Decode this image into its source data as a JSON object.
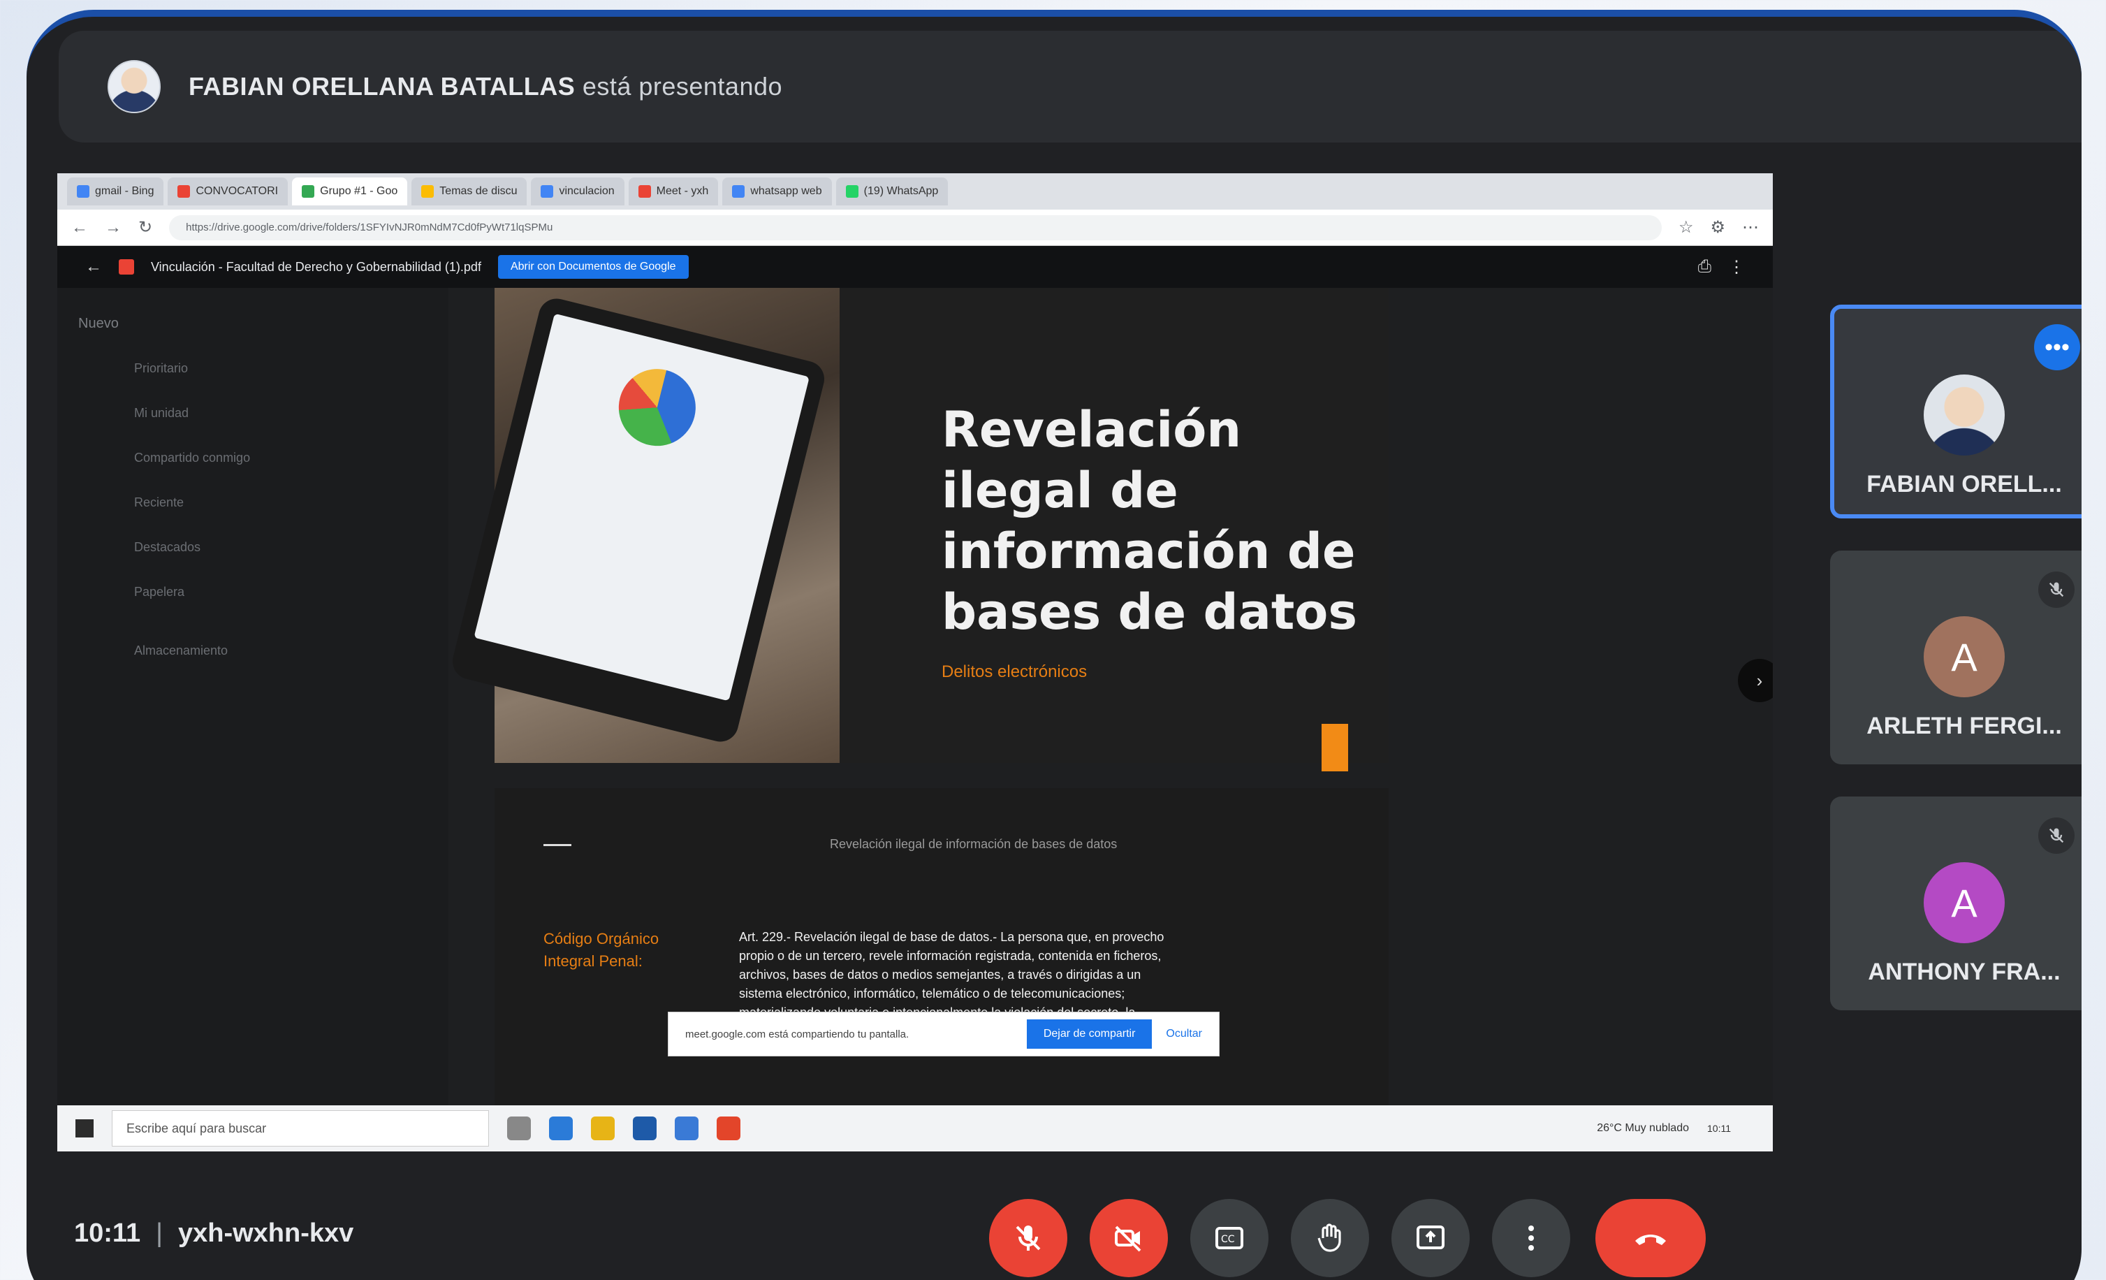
{
  "meeting": {
    "presenter_name": "FABIAN ORELLANA BATALLAS",
    "presenting_text": "está presentando",
    "time": "10:11",
    "code": "yxh-wxhn-kxv"
  },
  "browser": {
    "tabs": [
      {
        "label": "gmail - Bing"
      },
      {
        "label": "CONVOCATORI"
      },
      {
        "label": "Grupo #1 - Goo"
      },
      {
        "label": "Temas de discu"
      },
      {
        "label": "vinculacion"
      },
      {
        "label": "Meet - yxh"
      },
      {
        "label": "whatsapp web"
      },
      {
        "label": "(19) WhatsApp"
      }
    ],
    "url": "https://drive.google.com/drive/folders/1SFYIvNJR0mNdM7Cd0fPyWt71lqSPMu"
  },
  "drive": {
    "file_title": "Vinculación - Facultad de Derecho y Gobernabilidad (1).pdf",
    "open_with": "Abrir con Documentos de Google",
    "new_label": "Nuevo",
    "side_items": [
      {
        "label": "Prioritario"
      },
      {
        "label": "Mi unidad"
      },
      {
        "label": "Compartido conmigo"
      },
      {
        "label": "Reciente"
      },
      {
        "label": "Destacados"
      },
      {
        "label": "Papelera"
      },
      {
        "label": "Almacenamiento"
      }
    ]
  },
  "slide1": {
    "title": "Revelación ilegal de información de bases de datos",
    "subtitle": "Delitos electrónicos"
  },
  "slide2": {
    "header": "Revelación ilegal de información de bases de datos",
    "label": "Código Orgánico Integral Penal:",
    "body": "Art. 229.- Revelación ilegal de base de datos.- La persona que, en provecho propio o de un tercero, revele información registrada, contenida en ficheros, archivos, bases de datos o medios semejantes, a través o dirigidas a un sistema electrónico, informático, telemático o de telecomunicaciones; materializando voluntaria e intencionalmente la violación del secreto, la intimidad y"
  },
  "share_banner": {
    "text": "meet.google.com está compartiendo tu pantalla.",
    "stop_button": "Dejar de compartir",
    "hide_button": "Ocultar"
  },
  "taskbar": {
    "search_placeholder": "Escribe aquí para buscar",
    "weather": "26°C Muy nublado",
    "clock": "10:11"
  },
  "participants": [
    {
      "name": "FABIAN ORELL...",
      "initial": "",
      "color": "#dfe4ea"
    },
    {
      "name": "ARLETH FERGI...",
      "initial": "A",
      "color": "#a0725e"
    },
    {
      "name": "ANTHONY FRA...",
      "initial": "A",
      "color": "#b44ac4"
    }
  ],
  "controls": [
    {
      "name": "microphone-off",
      "color": "#ea4335"
    },
    {
      "name": "camera-off",
      "color": "#ea4335"
    },
    {
      "name": "captions",
      "color": "#3c4043"
    },
    {
      "name": "raise-hand",
      "color": "#3c4043"
    },
    {
      "name": "present-now",
      "color": "#3c4043"
    },
    {
      "name": "more-options",
      "color": "#3c4043"
    },
    {
      "name": "leave-call",
      "color": "#ea4335"
    }
  ]
}
